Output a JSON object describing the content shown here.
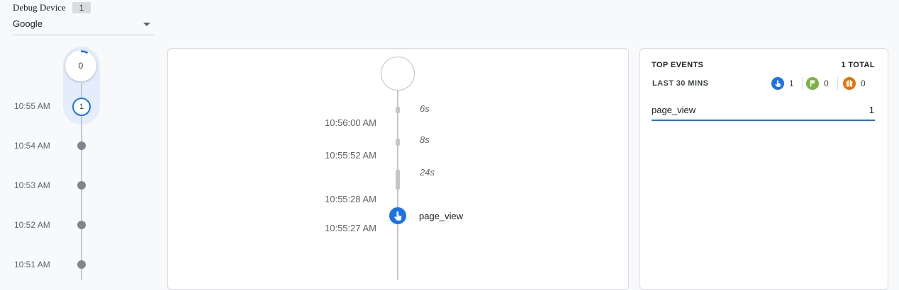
{
  "debug_device": {
    "label": "Debug Device",
    "count": "1",
    "selected": "Google"
  },
  "minutes_stream": {
    "current_count": "0",
    "times": [
      "10:55 AM",
      "10:54 AM",
      "10:53 AM",
      "10:52 AM",
      "10:51 AM"
    ],
    "first_minute_count": "1"
  },
  "seconds_stream": {
    "durations": [
      "6s",
      "8s",
      "24s"
    ],
    "times": [
      "10:56:00 AM",
      "10:55:52 AM",
      "10:55:28 AM",
      "10:55:27 AM"
    ],
    "event": {
      "name": "page_view",
      "icon": "touch-icon",
      "color": "#1a73e8"
    }
  },
  "top_events": {
    "title": "TOP EVENTS",
    "total": "1 TOTAL",
    "range": "LAST 30 MINS",
    "type_counts": [
      {
        "icon": "touch-icon",
        "color": "#1a73e8",
        "count": "1"
      },
      {
        "icon": "flag-icon",
        "color": "#7cb342",
        "count": "0"
      },
      {
        "icon": "gift-icon",
        "color": "#e8710a",
        "count": "0"
      }
    ],
    "events": [
      {
        "name": "page_view",
        "count": "1"
      }
    ]
  }
}
